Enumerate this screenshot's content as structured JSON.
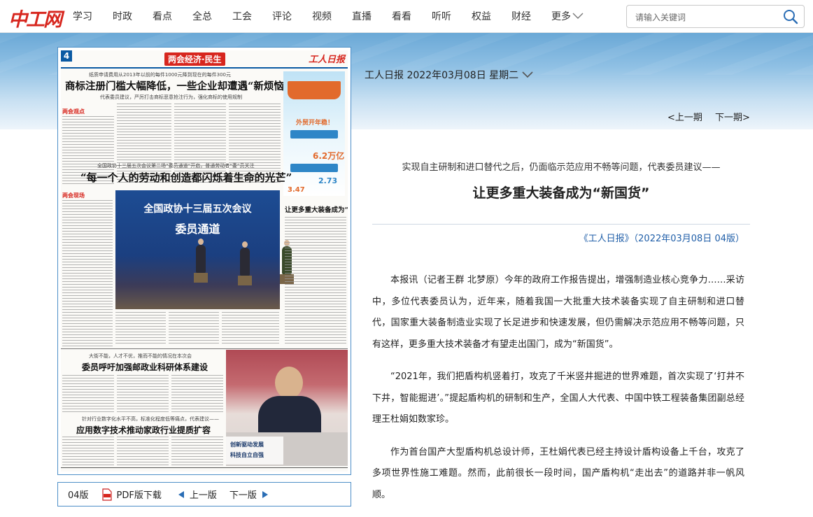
{
  "site": {
    "logo_text": "中工网",
    "search_placeholder": "请输入关键词"
  },
  "nav": {
    "items": [
      "学习",
      "时政",
      "看点",
      "全总",
      "工会",
      "评论",
      "视频",
      "直播",
      "看看",
      "听听",
      "权益",
      "财经"
    ],
    "more": "更多"
  },
  "paper": {
    "info": "工人日报 2022年03月08日 星期二",
    "prev_page": "<上一期",
    "next_page": "下一期>"
  },
  "newspaper": {
    "page_num": "4",
    "section": "两会经济·民生",
    "brand": "工人日报",
    "kicker1": "纸质申请费用从2013年以前的每件1000元降到现在的每件300元",
    "headline1": "商标注册门槛大幅降低，一些企业却遭遇“新烦恼”",
    "sub1": "代表委员建议，严厉打击商标恶意抢注行为，强化商标的使用规制",
    "tag1": "两会观点",
    "kicker2": "全国政协十三届五次会议第二场“委员通道”开启，普通劳动者“委”员关注",
    "headline2": "“每一个人的劳动和创造都闪烁着生命的光芒”",
    "tag2": "两会现场",
    "photo1_line1": "全国政协十三届五次会议",
    "photo1_line2": "委员通道",
    "article_small_title": "让更多重大装备成为“新国货”",
    "kicker3": "大街不能，人才不优，推而不能的情况在本次会",
    "headline3": "委员呼吁加强邮政业科研体系建设",
    "kicker4": "针对行业数字化水平不高，标准化程度低等痛点，代表建议——",
    "headline4": "应用数字技术推动家政行业提质扩容",
    "ad_text1": "外贸开年稳！",
    "ad_text2": "6.2万亿元",
    "ad_text3": "2.73",
    "ad_text4": "3.47",
    "photo2_caption1": "创新驱动发展",
    "photo2_caption2": "科技自立自强"
  },
  "toolbar": {
    "edition": "04版",
    "pdf": "PDF版下载",
    "prev": "上一版",
    "next": "下一版"
  },
  "article": {
    "kicker": "实现自主研制和进口替代之后，仍面临示范应用不畅等问题，代表委员建议——",
    "title": "让更多重大装备成为“新国货”",
    "source": "《工人日报》（2022年03月08日 04版）",
    "paragraphs": [
      "本报讯（记者王群 北梦原）今年的政府工作报告提出，增强制造业核心竞争力……采访中，多位代表委员认为，近年来，随着我国一大批重大技术装备实现了自主研制和进口替代，国家重大装备制造业实现了长足进步和快速发展，但仍需解决示范应用不畅等问题，只有这样，更多重大技术装备才有望走出国门，成为“新国货”。",
      "“2021年，我们把盾构机竖着打，攻克了千米竖井掘进的世界难题，首次实现了‘打井不下井，智能掘进’。”提起盾构机的研制和生产，全国人大代表、中国中铁工程装备集团副总经理王杜娟如数家珍。",
      "作为首台国产大型盾构机总设计师，王杜娟代表已经主持设计盾构设备上千台，攻克了多项世界性施工难题。然而，此前很长一段时间，国产盾构机“走出去”的道路并非一帆风顺。"
    ]
  },
  "colors": {
    "brand_red": "#d7261e",
    "link_blue": "#1f5ea8",
    "frame_blue": "#4d8fc8"
  }
}
